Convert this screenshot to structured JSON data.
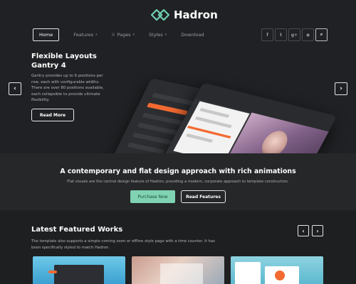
{
  "brand": {
    "name": "Hadron",
    "logo_icon": "interlocked-diamonds-icon",
    "accent": "#6fcfb0"
  },
  "nav": {
    "items": [
      {
        "label": "Home",
        "active": true,
        "has_caret": false
      },
      {
        "label": "Features",
        "active": false,
        "has_caret": true
      },
      {
        "label": "Pages",
        "active": false,
        "has_caret": true,
        "icon": "document-icon"
      },
      {
        "label": "Styles",
        "active": false,
        "has_caret": true
      },
      {
        "label": "Download",
        "active": false,
        "has_caret": false
      }
    ],
    "caret_glyph": "▾",
    "pages_glyph": "▤"
  },
  "social": {
    "facebook": "f",
    "twitter": "t",
    "google": "g+",
    "rss": "◉",
    "search": "⌕"
  },
  "hero": {
    "title_line1": "Flexible Layouts",
    "title_line2": "Gantry 4",
    "description": "Gantry provides up to 6 positions per row, each with configurable widths. There are over 80 positions available, each collapsible to provide ultimate flexibility.",
    "read_more": "Read More",
    "prev_glyph": "‹",
    "next_glyph": "›"
  },
  "band": {
    "title": "A contemporary and flat design approach with rich animations",
    "description": "Flat visuals are the central design feature of Hadron, providing a modern, corporate approach to template construction.",
    "purchase": "Purchase Now",
    "read_features": "Read Features",
    "purchase_color": "#7fd2b2"
  },
  "works": {
    "title": "Latest Featured Works",
    "description": "The template also supports a simple coming soon or offline style page with a time counter. It has been specifically styled to match Hadron.",
    "prev_glyph": "‹",
    "next_glyph": "›"
  }
}
